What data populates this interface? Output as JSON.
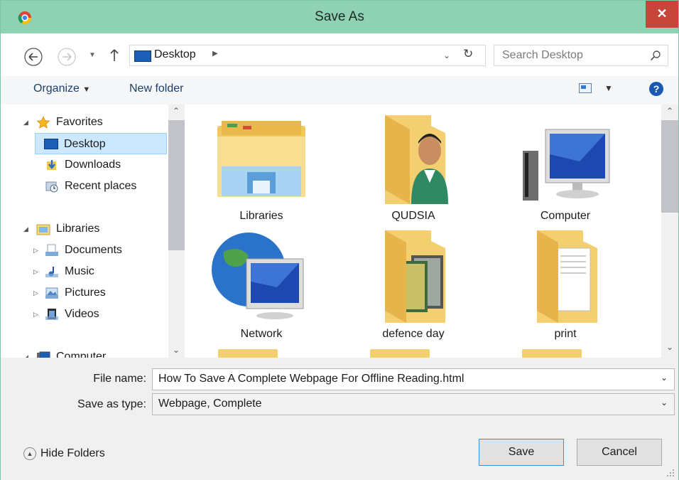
{
  "window": {
    "title": "Save As"
  },
  "address": {
    "location": "Desktop"
  },
  "search": {
    "placeholder": "Search Desktop"
  },
  "toolbar": {
    "organize": "Organize",
    "new_folder": "New folder"
  },
  "nav": {
    "favorites": "Favorites",
    "desktop": "Desktop",
    "downloads": "Downloads",
    "recent": "Recent places",
    "libraries": "Libraries",
    "documents": "Documents",
    "music": "Music",
    "pictures": "Pictures",
    "videos": "Videos",
    "computer": "Computer"
  },
  "items": {
    "libraries": "Libraries",
    "user": "QUDSIA",
    "computer": "Computer",
    "network": "Network",
    "folder1": "defence day",
    "folder2": "print"
  },
  "form": {
    "file_name_label": "File name:",
    "file_name": "How To Save A Complete Webpage For Offline Reading.html",
    "save_type_label": "Save as type:",
    "save_type": "Webpage, Complete"
  },
  "buttons": {
    "hide_folders": "Hide Folders",
    "save": "Save",
    "cancel": "Cancel"
  }
}
